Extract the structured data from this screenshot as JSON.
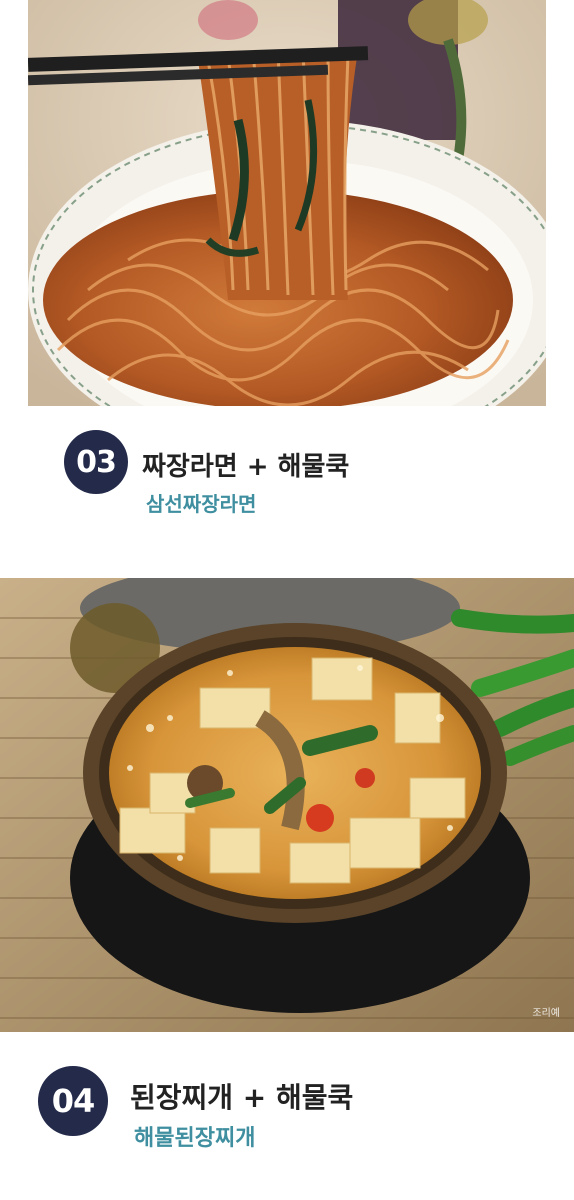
{
  "items": [
    {
      "number": "03",
      "title": "짜장라면 + 해물쿡",
      "subtitle": "삼선짜장라면"
    },
    {
      "number": "04",
      "title": "된장찌개 + 해물쿡",
      "subtitle": "해물된장찌개",
      "watermark": "조리예"
    }
  ],
  "colors": {
    "badge": "#232a4a",
    "subtitle": "#3f8fa0",
    "title": "#222222"
  },
  "icons": {
    "photo1": "jjajang-ramen-photo",
    "photo2": "doenjang-jjigae-photo"
  }
}
